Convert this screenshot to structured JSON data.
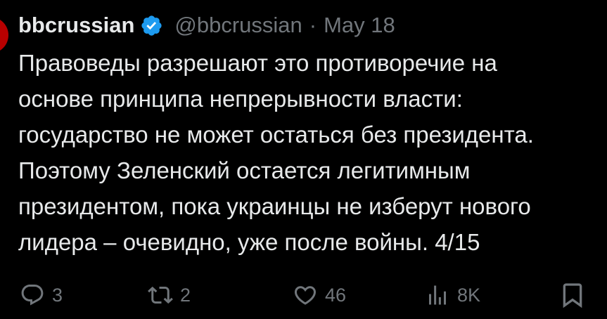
{
  "tweet": {
    "author_name": "bbcrussian",
    "handle": "@bbcrussian",
    "separator": "·",
    "date": "May 18",
    "text_lines": [
      "Правоведы разрешают это противоречие на",
      "основе принципа непрерывности власти:",
      "государство не может остаться без президента.",
      "Поэтому Зеленский остается легитимным",
      "президентом, пока украинцы не изберут нового",
      "лидера – очевидно, уже после войны. 4/15"
    ]
  },
  "actions": {
    "replies": "3",
    "reposts": "2",
    "likes": "46",
    "views": "8K"
  },
  "colors": {
    "background": "#000000",
    "text": "#e7e9ea",
    "muted": "#71767b",
    "verified": "#1d9bf0",
    "avatar": "#b80000"
  },
  "icons": [
    "verified-badge-icon",
    "reply-icon",
    "repost-icon",
    "like-icon",
    "views-icon",
    "bookmark-icon"
  ]
}
